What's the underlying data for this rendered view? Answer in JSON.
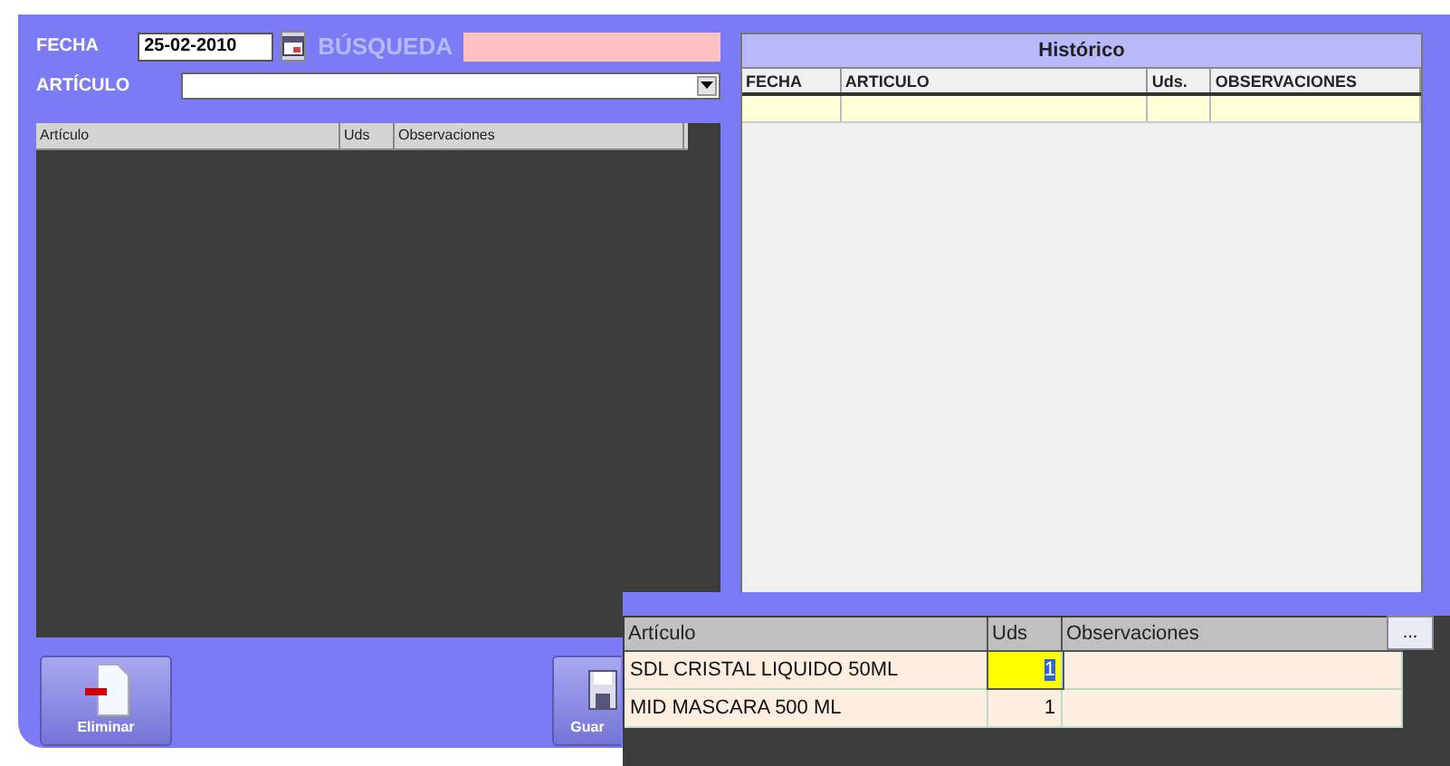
{
  "form": {
    "fecha_label": "FECHA",
    "fecha_value": "25-02-2010",
    "busqueda_label": "BÚSQUEDA",
    "articulo_label": "ARTÍCULO"
  },
  "grid": {
    "columns": [
      "Artículo",
      "Uds",
      "Observaciones"
    ]
  },
  "historico": {
    "title": "Histórico",
    "columns": [
      "FECHA",
      "ARTICULO",
      "Uds.",
      "OBSERVACIONES"
    ]
  },
  "buttons": [
    {
      "label": "Eliminar",
      "kind": "delete"
    },
    {
      "label": "Guar",
      "kind": "save"
    }
  ],
  "inset": {
    "columns": [
      "Artículo",
      "Uds",
      "Observaciones"
    ],
    "more_button": "...",
    "rows": [
      {
        "articulo": "SDL CRISTAL LIQUIDO 50ML",
        "uds": "1",
        "selected": true
      },
      {
        "articulo": "MID MASCARA 500 ML",
        "uds": "1",
        "selected": false
      }
    ]
  }
}
